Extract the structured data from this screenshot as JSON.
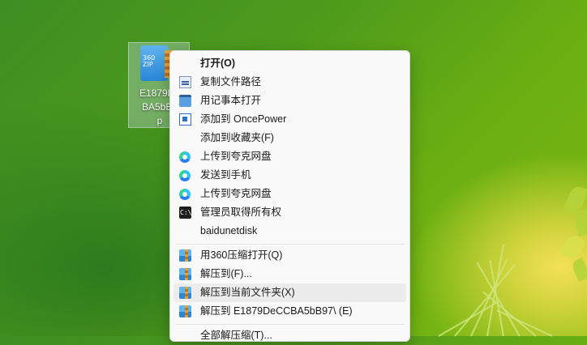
{
  "desktop_icon": {
    "badge": "360\nZIP",
    "name_lines": [
      "E1879De",
      "BA5bB9",
      "p"
    ]
  },
  "context_menu": {
    "items": [
      {
        "label": "打开(O)",
        "icon": "none-icon",
        "bold": true
      },
      {
        "label": "复制文件路径",
        "icon": "copy-path-icon"
      },
      {
        "label": "用记事本打开",
        "icon": "notepad-icon"
      },
      {
        "label": "添加到 OncePower",
        "icon": "oncepower-icon"
      },
      {
        "label": "添加到收藏夹(F)",
        "icon": "none-icon"
      },
      {
        "label": "上传到夸克网盘",
        "icon": "quark-cloud-icon"
      },
      {
        "label": "发送到手机",
        "icon": "quark-cloud-icon"
      },
      {
        "label": "上传到夸克网盘",
        "icon": "quark-cloud-icon"
      },
      {
        "label": "管理员取得所有权",
        "icon": "cmd-icon"
      },
      {
        "label": "baidunetdisk",
        "icon": "none-icon"
      },
      {
        "label": "用360压缩打开(Q)",
        "icon": "zip-360-icon"
      },
      {
        "label": "解压到(F)...",
        "icon": "zip-360-icon"
      },
      {
        "label": "解压到当前文件夹(X)",
        "icon": "zip-360-icon",
        "highlighted": true
      },
      {
        "label": "解压到 E1879DeCCBA5bB97\\ (E)",
        "icon": "zip-360-icon"
      },
      {
        "label": "全部解压缩(T)...",
        "icon": "none-icon"
      }
    ],
    "cmd_icon_text": "C:\\"
  },
  "colors": {
    "menu_bg": "#f9f9f9",
    "highlight": "#ececec",
    "desktop_green": "#4c9a1c"
  }
}
